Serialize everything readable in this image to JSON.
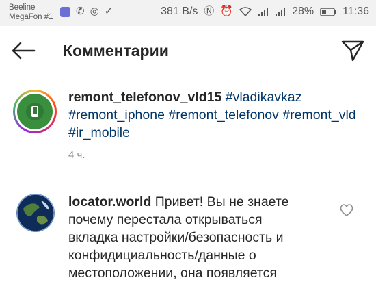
{
  "status_bar": {
    "carrier_line1": "Beeline",
    "carrier_line2": "MegaFon #1",
    "speed": "381 B/s",
    "battery": "28%",
    "time": "11:36"
  },
  "header": {
    "title": "Комментарии",
    "back_icon": "arrow-left-icon",
    "send_icon": "paper-plane-icon"
  },
  "caption": {
    "username": "remont_telefonov_vld15",
    "tags": [
      "#vladikavkaz",
      "#remont_iphone",
      "#remont_telefonov",
      "#remont_vld",
      "#ir_mobile"
    ],
    "time": "4 ч."
  },
  "comment": {
    "username": "locator.world",
    "text": "Привет! Вы не знаете почему перестала открываться вкладка настройки/безопасность и конфидициальность/данные о местоположении, она появляется"
  },
  "colors": {
    "link": "#003569",
    "muted": "#8e8e8e",
    "text": "#262626"
  }
}
